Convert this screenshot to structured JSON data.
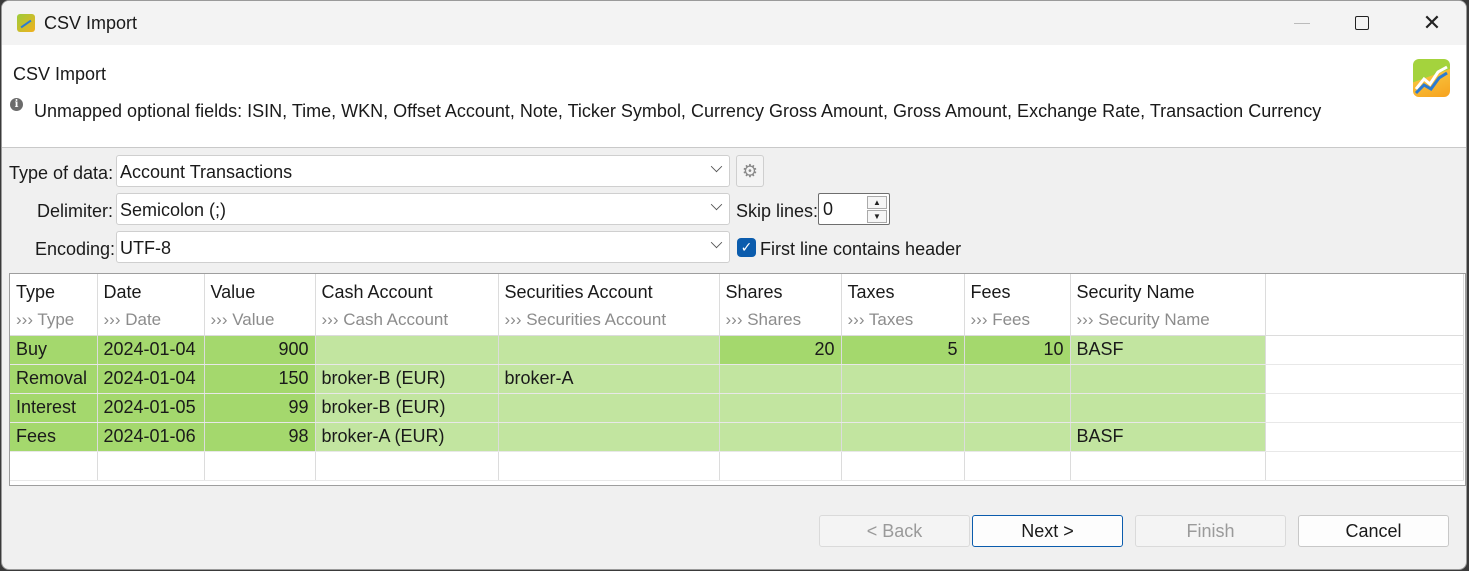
{
  "window": {
    "title": "CSV Import",
    "close_glyph": "✕"
  },
  "header": {
    "title": "CSV Import",
    "info": "Unmapped optional fields: ISIN, Time, WKN, Offset Account, Note, Ticker Symbol, Currency Gross Amount, Gross Amount, Exchange Rate, Transaction Currency",
    "info_icon": "i"
  },
  "form": {
    "type_label": "Type of data:",
    "type_value": "Account Transactions",
    "delimiter_label": "Delimiter:",
    "delimiter_value": "Semicolon (;)",
    "encoding_label": "Encoding:",
    "encoding_value": "UTF-8",
    "skip_label": "Skip lines:",
    "skip_value": "0",
    "header_label": "First line contains header",
    "header_checked": true
  },
  "table": {
    "columns": [
      {
        "name": "Type",
        "mapping": "››› Type"
      },
      {
        "name": "Date",
        "mapping": "››› Date"
      },
      {
        "name": "Value",
        "mapping": "››› Value"
      },
      {
        "name": "Cash Account",
        "mapping": "››› Cash Account"
      },
      {
        "name": "Securities Account",
        "mapping": "››› Securities Account"
      },
      {
        "name": "Shares",
        "mapping": "››› Shares"
      },
      {
        "name": "Taxes",
        "mapping": "››› Taxes"
      },
      {
        "name": "Fees",
        "mapping": "››› Fees"
      },
      {
        "name": "Security Name",
        "mapping": "››› Security Name"
      }
    ],
    "rows": [
      {
        "c": [
          "Buy",
          "2024-01-04",
          "900",
          "",
          "",
          "20",
          "5",
          "10",
          "BASF"
        ]
      },
      {
        "c": [
          "Removal",
          "2024-01-04",
          "150",
          "broker-B (EUR)",
          "broker-A",
          "",
          "",
          "",
          ""
        ]
      },
      {
        "c": [
          "Interest",
          "2024-01-05",
          "99",
          "broker-B (EUR)",
          "",
          "",
          "",
          "",
          ""
        ]
      },
      {
        "c": [
          "Fees",
          "2024-01-06",
          "98",
          "broker-A (EUR)",
          "",
          "",
          "",
          "",
          "BASF"
        ]
      }
    ],
    "colors": {
      "mapped": "#a4d86d",
      "unmapped": "#c2e5a0"
    }
  },
  "buttons": {
    "back": "< Back",
    "next": "Next >",
    "finish": "Finish",
    "cancel": "Cancel"
  }
}
